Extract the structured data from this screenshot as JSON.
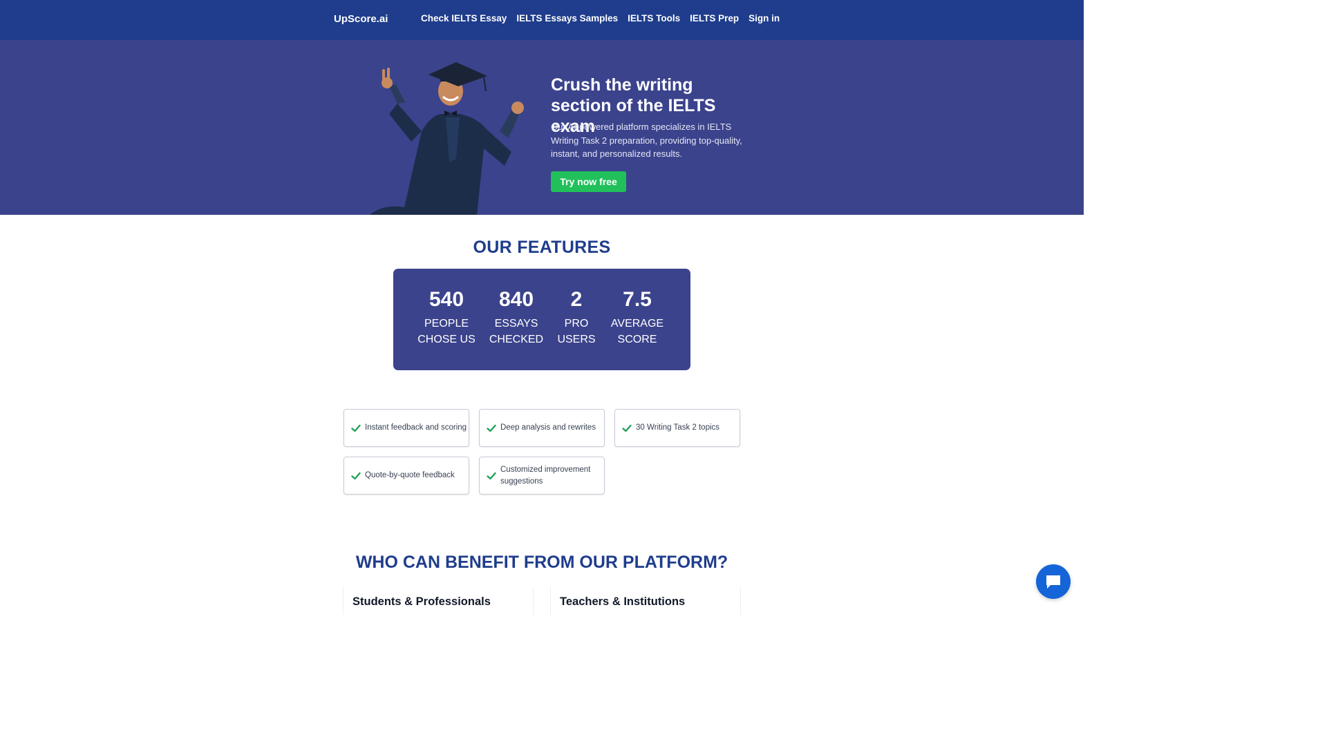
{
  "navbar": {
    "brand": "UpScore.ai",
    "links": [
      {
        "label": "Check IELTS Essay"
      },
      {
        "label": "IELTS Essays Samples"
      },
      {
        "label": "IELTS Tools"
      },
      {
        "label": "IELTS Prep"
      },
      {
        "label": "Sign in"
      }
    ]
  },
  "hero": {
    "title": "Crush the writing section of the IELTS exam",
    "description": "Our AI-powered platform specializes in IELTS Writing Task 2 preparation, providing top-quality, instant, and personalized results.",
    "cta_label": "Try now free",
    "image_subject": "graduate-celebrating"
  },
  "features": {
    "heading": "OUR FEATURES",
    "stats": [
      {
        "value": "540",
        "label": "PEOPLE\nCHOSE US"
      },
      {
        "value": "840",
        "label": "ESSAYS\nCHECKED"
      },
      {
        "value": "2",
        "label": "PRO\nUSERS"
      },
      {
        "value": "7.5",
        "label": "AVERAGE\nSCORE"
      }
    ],
    "items": [
      {
        "label": "Instant feedback and scoring"
      },
      {
        "label": "Deep analysis and rewrites"
      },
      {
        "label": "30 Writing Task 2 topics"
      },
      {
        "label": "Quote-by-quote feedback"
      },
      {
        "label": "Customized improvement suggestions"
      }
    ]
  },
  "benefits": {
    "heading": "WHO CAN BENEFIT FROM OUR PLATFORM?",
    "cards": [
      {
        "title": "Students & Professionals"
      },
      {
        "title": "Teachers & Institutions"
      }
    ]
  },
  "chat": {
    "icon": "chat-bubble-icon"
  },
  "colors": {
    "navbar": "#1f3d8c",
    "hero_bg": "#3b438c",
    "cta": "#22c05b",
    "heading": "#1f3d8c",
    "check": "#22a05a",
    "chat": "#1565d8"
  }
}
